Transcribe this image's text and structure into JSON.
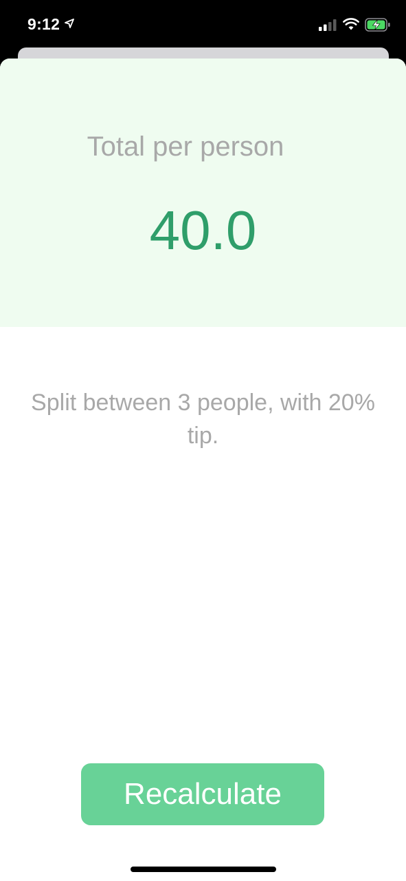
{
  "status_bar": {
    "time": "9:12",
    "icons": [
      "location-arrow-icon",
      "cellular-signal-icon",
      "wifi-icon",
      "battery-charging-icon"
    ],
    "battery_color": "#4cd964"
  },
  "result": {
    "label": "Total per person",
    "value": "40.0",
    "background_color": "#effcf0",
    "value_color": "#2f9e6a"
  },
  "settings": {
    "text": "Split between 3 people, with 20% tip."
  },
  "actions": {
    "recalculate_label": "Recalculate",
    "button_color": "#68d297"
  }
}
